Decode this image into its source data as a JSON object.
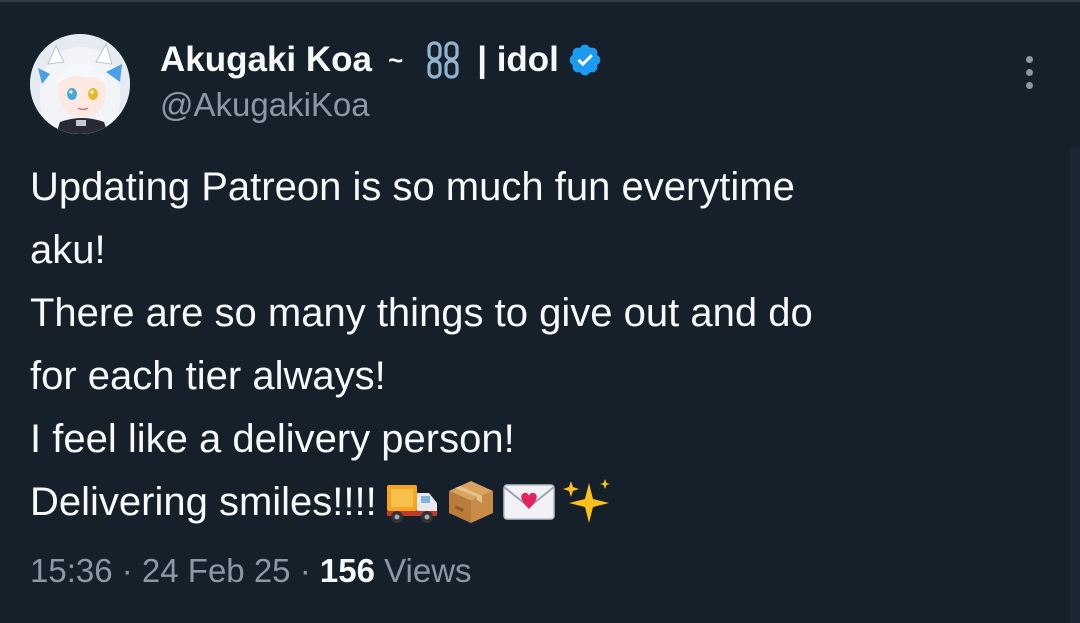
{
  "author": {
    "display_name": "Akugaki Koa",
    "wave_glyph": "~",
    "chain_icon": "chain-link-icon",
    "tag": "| idol",
    "verified_icon": "verified-badge-icon",
    "handle": "@AkugakiKoa"
  },
  "tweet": {
    "lines": [
      "Updating Patreon is so much fun everytime",
      "aku!",
      "There are so many things to give out and do",
      "for each tier always!",
      "I feel like a delivery person!",
      "Delivering smiles!!!!"
    ],
    "emojis": [
      "delivery-truck-emoji",
      "package-emoji",
      "love-letter-emoji",
      "sparkles-emoji"
    ]
  },
  "meta": {
    "time": "15:36",
    "sep1": " · ",
    "date": "24 Feb 25",
    "sep2": " · ",
    "views_count": "156",
    "views_label": " Views"
  },
  "colors": {
    "background": "#15202b",
    "text": "#f7f9f9",
    "secondary": "#8b98a5",
    "verified": "#1d9bf0"
  }
}
